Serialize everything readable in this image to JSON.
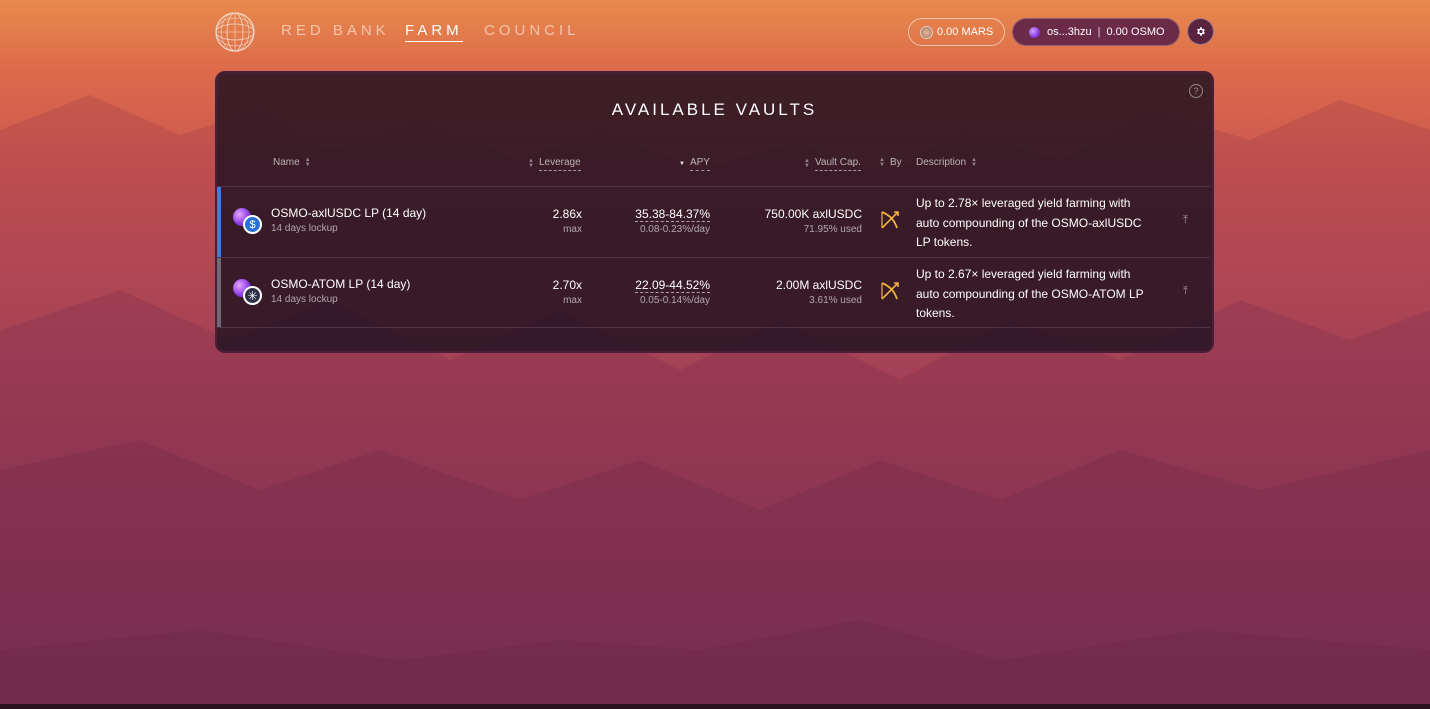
{
  "nav": {
    "links": [
      "RED BANK",
      "FARM",
      "COUNCIL"
    ],
    "active": "FARM"
  },
  "wallet": {
    "mars_balance": "0.00 MARS",
    "address": "os...3hzu",
    "osmo_balance": "0.00 OSMO"
  },
  "colors": {
    "accent_blue": "#3b7de0",
    "row_marker_grey": "#6e6a72",
    "by_icon": "#f2b53a"
  },
  "vaults": {
    "title": "AVAILABLE VAULTS",
    "columns": {
      "name": "Name",
      "leverage": "Leverage",
      "apy": "APY",
      "vault_cap": "Vault Cap.",
      "by": "By",
      "description": "Description"
    },
    "rows": [
      {
        "name": "OSMO-axlUSDC LP (14 day)",
        "lockup": "14 days lockup",
        "leverage": "2.86x",
        "leverage_sub": "max",
        "apy": "35.38-84.37%",
        "apy_day": "0.08-0.23%/day",
        "cap": "750.00K axlUSDC",
        "cap_used": "71.95% used",
        "description": "Up to 2.78× leveraged yield farming with auto compounding of the OSMO-axlUSDC LP tokens.",
        "second_token_icon": "dollar-coin-icon"
      },
      {
        "name": "OSMO-ATOM LP (14 day)",
        "lockup": "14 days lockup",
        "leverage": "2.70x",
        "leverage_sub": "max",
        "apy": "22.09-44.52%",
        "apy_day": "0.05-0.14%/day",
        "cap": "2.00M axlUSDC",
        "cap_used": "3.61% used",
        "description": "Up to 2.67× leveraged yield farming with auto compounding of the OSMO-ATOM LP tokens.",
        "second_token_icon": "atom-icon"
      }
    ]
  }
}
